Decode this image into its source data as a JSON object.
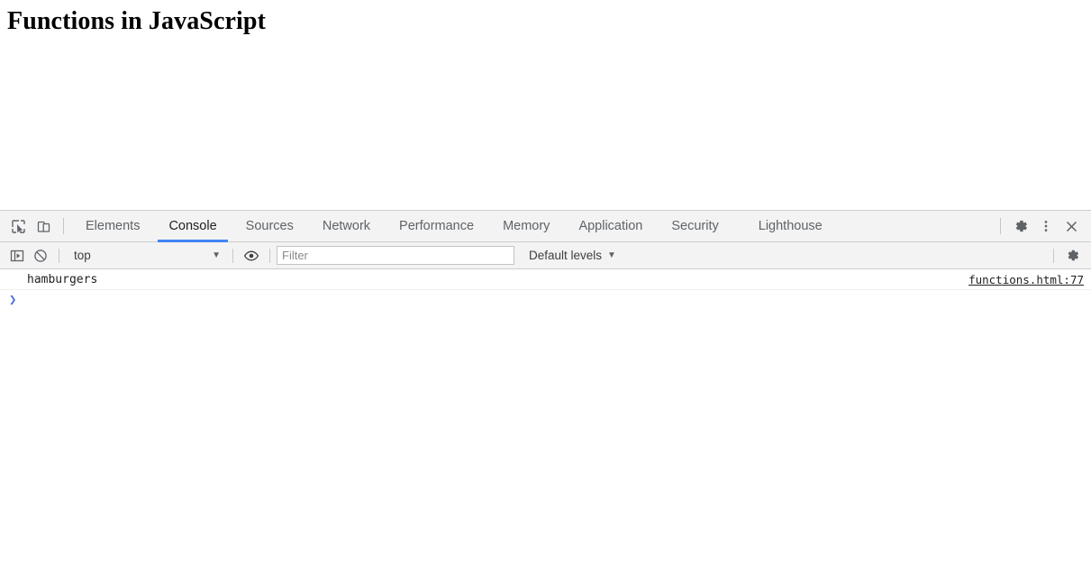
{
  "page": {
    "title": "Functions in JavaScript"
  },
  "devtools": {
    "toolbar_icons": {
      "inspect": "inspect-element-icon",
      "device": "device-toolbar-icon",
      "settings": "gear-icon",
      "more": "kebab-menu-icon",
      "close": "close-icon"
    },
    "tabs": [
      {
        "label": "Elements",
        "active": false
      },
      {
        "label": "Console",
        "active": true
      },
      {
        "label": "Sources",
        "active": false
      },
      {
        "label": "Network",
        "active": false
      },
      {
        "label": "Performance",
        "active": false
      },
      {
        "label": "Memory",
        "active": false
      },
      {
        "label": "Application",
        "active": false
      },
      {
        "label": "Security",
        "active": false
      },
      {
        "label": "Lighthouse",
        "active": false
      }
    ],
    "console_toolbar": {
      "sidebar_toggle_icon": "sidebar-toggle-icon",
      "clear_icon": "clear-console-icon",
      "context": "top",
      "context_caret": "▼",
      "eye_icon": "eye-icon",
      "filter_placeholder": "Filter",
      "filter_value": "",
      "levels_label": "Default levels",
      "levels_caret": "▼",
      "settings_icon": "gear-icon"
    },
    "console_messages": [
      {
        "text": "hamburgers",
        "source": "functions.html:77"
      }
    ],
    "prompt": {
      "arrow": "❯",
      "value": ""
    },
    "colors": {
      "active_tab_underline": "#4285f4",
      "toolbar_bg": "#f3f3f3",
      "border": "#cdcdcd",
      "prompt_arrow": "#4a6fd4",
      "left_edge": "#9fc3d5"
    }
  }
}
